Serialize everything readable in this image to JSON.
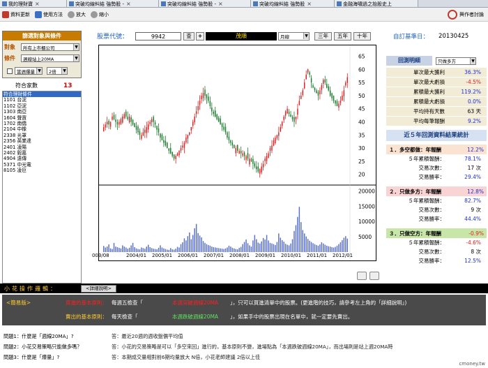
{
  "tabs": [
    {
      "label": "我的理財寶"
    },
    {
      "label": "突破均線糾結 強勢股 -"
    },
    {
      "label": "突破均線糾結 強勢股 -"
    },
    {
      "label": "突破均線糾結 強勢股"
    },
    {
      "label": "金融海嘯過之抬股史上"
    }
  ],
  "toolbar": {
    "refresh_label": "資料更新",
    "help_label": "使用方法",
    "zoom_in_label": "放大",
    "zoom_out_label": "縮小",
    "brand_label": "興作者討論"
  },
  "filter": {
    "title": "篩選對象與條件",
    "object_label": "對象",
    "object_value": "所有上市櫃公司",
    "condition_label": "條件",
    "condition_value": "週線站上20MA",
    "extra_checkbox_value": "當週爆量",
    "extra_multiplier": "2倍"
  },
  "match": {
    "label": "符合家數",
    "count": "13"
  },
  "stocks": [
    {
      "label": "符合理財條件",
      "selected": true
    },
    {
      "label": "1101 台泥"
    },
    {
      "label": "1102 亞泥"
    },
    {
      "label": "1303 南亞"
    },
    {
      "label": "1604 聲寶"
    },
    {
      "label": "1702 南僑"
    },
    {
      "label": "2104 中橡"
    },
    {
      "label": "2338 光罩"
    },
    {
      "label": "2356 英業達"
    },
    {
      "label": "2401 凌陽"
    },
    {
      "label": "2402 毅嘉"
    },
    {
      "label": "4904 遠傳"
    },
    {
      "label": "5371 中光電"
    },
    {
      "label": "8105 凌巨"
    }
  ],
  "header": {
    "code_label": "股票代號：",
    "code_value": "9942",
    "lookup_label": "查",
    "plus_label": "+",
    "stock_name": "茂順",
    "period_value": "月線",
    "btn_3y": "三年",
    "btn_5y": "五年",
    "btn_10y": "十年",
    "custom_label": "自訂基準日：",
    "base_date": "20130425"
  },
  "chart_data": {
    "type": "candlestick",
    "price_axis_ticks": [
      "65",
      "60",
      "55",
      "50",
      "45",
      "40",
      "35",
      "30",
      "25",
      "20"
    ],
    "volume_axis_ticks": [
      "20000",
      "15000",
      "10000",
      "5000"
    ],
    "x_ticks": [
      "003/08",
      "2004/01",
      "2005/01",
      "2006/01",
      "2007/01",
      "2008/01",
      "2009/01",
      "2010/01",
      "2011/01",
      "2012/01"
    ],
    "ylim_price": [
      17,
      67
    ],
    "ylim_volume": [
      0,
      21000
    ],
    "price_path": [
      38,
      39,
      40,
      39,
      40,
      42,
      41,
      40,
      39,
      40,
      41,
      42,
      43,
      42,
      41,
      42,
      40,
      39,
      38,
      37,
      36,
      35,
      35,
      36,
      37,
      38,
      39,
      40,
      41,
      40,
      39,
      37,
      36,
      34,
      33,
      32,
      31,
      30,
      29,
      28,
      27,
      26,
      27,
      28,
      29,
      30,
      31,
      32,
      34,
      35,
      36,
      38,
      40,
      42,
      44,
      46,
      48,
      50,
      51,
      50,
      49,
      48,
      46,
      44,
      43,
      42,
      41,
      40,
      39,
      38,
      37,
      36,
      34,
      33,
      32,
      31,
      30,
      30,
      29,
      29,
      28,
      28,
      27,
      27,
      26,
      26,
      25,
      24,
      23,
      22,
      21,
      22,
      23,
      24,
      26,
      27,
      28,
      30,
      31,
      33,
      34,
      35,
      36,
      38,
      40,
      42,
      44,
      45,
      43,
      42,
      41,
      40,
      42,
      45,
      48,
      50,
      52,
      55,
      58,
      60,
      58,
      55,
      53,
      52,
      51,
      50,
      52,
      54,
      56,
      55,
      53,
      52,
      50,
      49,
      48,
      47,
      46,
      47,
      48,
      50,
      52,
      55,
      57
    ],
    "volume_path": [
      2000,
      1500,
      1800,
      2500,
      1200,
      1000,
      3000,
      1800,
      1600,
      1400,
      1200,
      2200,
      1800,
      1500,
      1100,
      1400,
      2200,
      3000,
      1600,
      1200,
      1000,
      900,
      1500,
      1300,
      1100,
      1800,
      2400,
      1600,
      1300,
      1100,
      1000,
      900,
      1400,
      2200,
      1500,
      1200,
      1000,
      800,
      700,
      1300,
      900,
      800,
      1100,
      1700,
      1500,
      2600,
      3200,
      4500,
      3800,
      5200,
      6400,
      4200,
      5600,
      7800,
      9200,
      6200,
      5400,
      4800,
      3600,
      3000,
      2600,
      2300,
      2100,
      1800,
      1600,
      1500,
      1400,
      1300,
      1200,
      1100,
      1000,
      1200,
      1500,
      2100,
      1800,
      1400,
      1200,
      1000,
      900,
      1400,
      1700,
      2600,
      3300,
      4100,
      2900,
      2200,
      1800,
      3800,
      5600,
      4200,
      3100,
      2800,
      3500,
      4600,
      4100,
      5600,
      3800,
      3000,
      2800,
      2600,
      2300,
      3300,
      6100,
      4700,
      3900,
      3400,
      2700,
      2400,
      2200,
      2800,
      4200,
      6900,
      8800,
      11500,
      14800,
      9800,
      7200,
      6100,
      5100,
      4300,
      3700,
      3300,
      2900,
      2600,
      2300,
      2100,
      2500,
      3200,
      2800,
      2400,
      2100,
      1900,
      1800,
      1600,
      1500,
      1700,
      2100,
      2600,
      3200,
      3900,
      4700,
      5200,
      4400
    ]
  },
  "backtest": {
    "title": "回測明細",
    "mode_value": "只做多方",
    "rows": [
      {
        "label": "單次最大獲利",
        "value": "36.3%",
        "color": "#1a2fd6"
      },
      {
        "label": "單次最大虧損",
        "value": "-4.5%",
        "color": "#e02020"
      },
      {
        "label": "累積最大獲利",
        "value": "119.2%",
        "color": "#1a2fd6"
      },
      {
        "label": "累積最大虧損",
        "value": "0.0%",
        "color": "#1a2fd6"
      },
      {
        "label": "平均持有天數",
        "value": "63 天",
        "color": "#000000"
      },
      {
        "label": "平均每筆報酬",
        "value": "9.2%",
        "color": "#1a2fd6"
      }
    ]
  },
  "stats": {
    "title": "近５年回測資料結果統計",
    "blocks": [
      {
        "head": "１．多空都做：年報酬",
        "head_value": "12.2%",
        "bg": "#fbe3d2",
        "value_color": "#1a2fd6",
        "rows": [
          {
            "label": "５年累積報酬：",
            "value": "78.1%",
            "color": "#1a2fd6"
          },
          {
            "label": "交易次數：",
            "value": "17 次",
            "color": "#000000"
          },
          {
            "label": "交易勝率：",
            "value": "29.4%",
            "color": "#1a2fd6"
          }
        ]
      },
      {
        "head": "２．只做多方：年報酬",
        "head_value": "12.8%",
        "bg": "#f8d4d4",
        "value_color": "#1a2fd6",
        "rows": [
          {
            "label": "５年累積報酬：",
            "value": "82.7%",
            "color": "#1a2fd6"
          },
          {
            "label": "交易次數：",
            "value": "9 次",
            "color": "#000000"
          },
          {
            "label": "交易勝率：",
            "value": "44.4%",
            "color": "#1a2fd6"
          }
        ]
      },
      {
        "head": "３．只做空方：年報酬",
        "head_value": "-0.9%",
        "bg": "#c8e6a8",
        "value_color": "#e02020",
        "rows": [
          {
            "label": "５年累積報酬：",
            "value": "-4.6%",
            "color": "#e02020"
          },
          {
            "label": "交易次數：",
            "value": "8 次",
            "color": "#000000"
          },
          {
            "label": "交易勝率：",
            "value": "12.5%",
            "color": "#1a2fd6"
          }
        ]
      }
    ]
  },
  "logic": {
    "title": "小花操作邏輯：",
    "detail_button": "<詳細說明>",
    "version_label": "<簡易版>",
    "buy_rule": "買進的基本原則：",
    "buy_when": "每週五檢查「",
    "buy_cond": "本週突破週線20MA",
    "buy_text": "」，只可以買進清單中的股票。(更進階的技巧，請參考左上角的「詳細說明」)",
    "sell_rule": "賣出的基本原則：",
    "sell_when": "每天檢查「",
    "sell_cond": "本週跌破週線20MA",
    "sell_text": "」，如果手中的股票出現在名單中，就一定要先賣出。"
  },
  "faq": [
    {
      "q": "問題1：什麼是「週線20MA」?",
      "a": "答：最近20週的週收盤價平均值"
    },
    {
      "q": "問題2：小花交易策略只能做多嗎？",
      "a": "答：小花的交易策略是可以「多空來回」進行的，基本原則不變，進場點為「本週跌破週線20MA」，而出場則是站上週20MA時"
    },
    {
      "q": "問題3：什麼是「爆量」?",
      "a": "答：本期成交量相對前6期均量放大 N倍，小花老師建議 2倍以上佳"
    }
  ],
  "footer": "cmoney.tw",
  "colors": {
    "up": "#e02020",
    "down": "#1a7a2c",
    "volume": "#5b72c8",
    "accent_orange": "#c77b00",
    "accent_red": "#ff2020"
  }
}
